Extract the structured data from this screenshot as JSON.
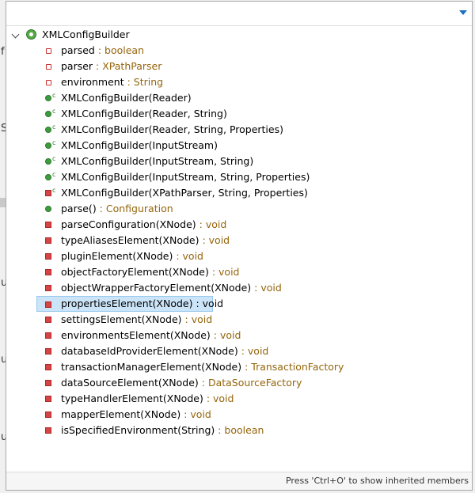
{
  "filter": {
    "value": ""
  },
  "outline": {
    "root": {
      "label": "XMLConfigBuilder",
      "icon": "class-icon"
    },
    "members": [
      {
        "name": "parsed",
        "type": " : boolean",
        "kind": "field-private"
      },
      {
        "name": "parser",
        "type": " : XPathParser",
        "kind": "field-private"
      },
      {
        "name": "environment",
        "type": " : String",
        "kind": "field-private"
      },
      {
        "name": "XMLConfigBuilder(Reader)",
        "type": "",
        "kind": "ctor-public"
      },
      {
        "name": "XMLConfigBuilder(Reader, String)",
        "type": "",
        "kind": "ctor-public"
      },
      {
        "name": "XMLConfigBuilder(Reader, String, Properties)",
        "type": "",
        "kind": "ctor-public"
      },
      {
        "name": "XMLConfigBuilder(InputStream)",
        "type": "",
        "kind": "ctor-public"
      },
      {
        "name": "XMLConfigBuilder(InputStream, String)",
        "type": "",
        "kind": "ctor-public"
      },
      {
        "name": "XMLConfigBuilder(InputStream, String, Properties)",
        "type": "",
        "kind": "ctor-public"
      },
      {
        "name": "XMLConfigBuilder(XPathParser, String, Properties)",
        "type": "",
        "kind": "ctor-private"
      },
      {
        "name": "parse()",
        "type": " : Configuration",
        "kind": "method-public"
      },
      {
        "name": "parseConfiguration(XNode)",
        "type": " : void",
        "kind": "method-private"
      },
      {
        "name": "typeAliasesElement(XNode)",
        "type": " : void",
        "kind": "method-private"
      },
      {
        "name": "pluginElement(XNode)",
        "type": " : void",
        "kind": "method-private"
      },
      {
        "name": "objectFactoryElement(XNode)",
        "type": " : void",
        "kind": "method-private"
      },
      {
        "name": "objectWrapperFactoryElement(XNode)",
        "type": " : void",
        "kind": "method-private"
      },
      {
        "name": "propertiesElement(XNode)",
        "type": " : void",
        "kind": "method-private",
        "selected": true
      },
      {
        "name": "settingsElement(XNode)",
        "type": " : void",
        "kind": "method-private"
      },
      {
        "name": "environmentsElement(XNode)",
        "type": " : void",
        "kind": "method-private"
      },
      {
        "name": "databaseIdProviderElement(XNode)",
        "type": " : void",
        "kind": "method-private"
      },
      {
        "name": "transactionManagerElement(XNode)",
        "type": " : TransactionFactory",
        "kind": "method-private"
      },
      {
        "name": "dataSourceElement(XNode)",
        "type": " : DataSourceFactory",
        "kind": "method-private"
      },
      {
        "name": "typeHandlerElement(XNode)",
        "type": " : void",
        "kind": "method-private"
      },
      {
        "name": "mapperElement(XNode)",
        "type": " : void",
        "kind": "method-private"
      },
      {
        "name": "isSpecifiedEnvironment(String)",
        "type": " : boolean",
        "kind": "method-private"
      }
    ]
  },
  "footer": {
    "hint": "Press 'Ctrl+O' to show inherited members"
  },
  "colors": {
    "type_text": "#95650c",
    "selection": "#cce4f7",
    "public_icon": "#3e9b3e",
    "private_icon": "#d64545"
  }
}
